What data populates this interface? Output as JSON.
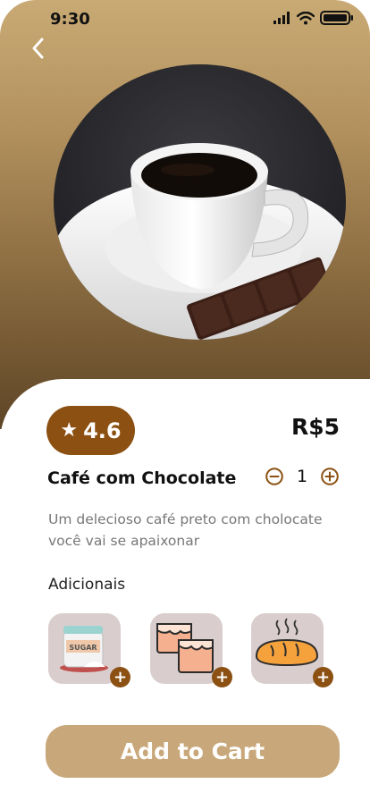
{
  "status_bar": {
    "time": "9:30"
  },
  "product": {
    "rating": "4.6",
    "price": "R$5",
    "name": "Café com Chocolate",
    "quantity": "1",
    "description": "Um delecioso café preto com cholocate você vai se apaixonar"
  },
  "addons": {
    "heading": "Adicionais",
    "items": [
      {
        "name": "sugar",
        "label": "SUGAR"
      },
      {
        "name": "caramel-cubes"
      },
      {
        "name": "bread"
      }
    ]
  },
  "cart": {
    "label": "Add to Cart"
  },
  "colors": {
    "accent": "#8b5012",
    "button": "#c8a87a",
    "hero_top": "#c9aa74",
    "hero_bottom": "#5e4526",
    "addon_bg": "#d9cecd"
  }
}
